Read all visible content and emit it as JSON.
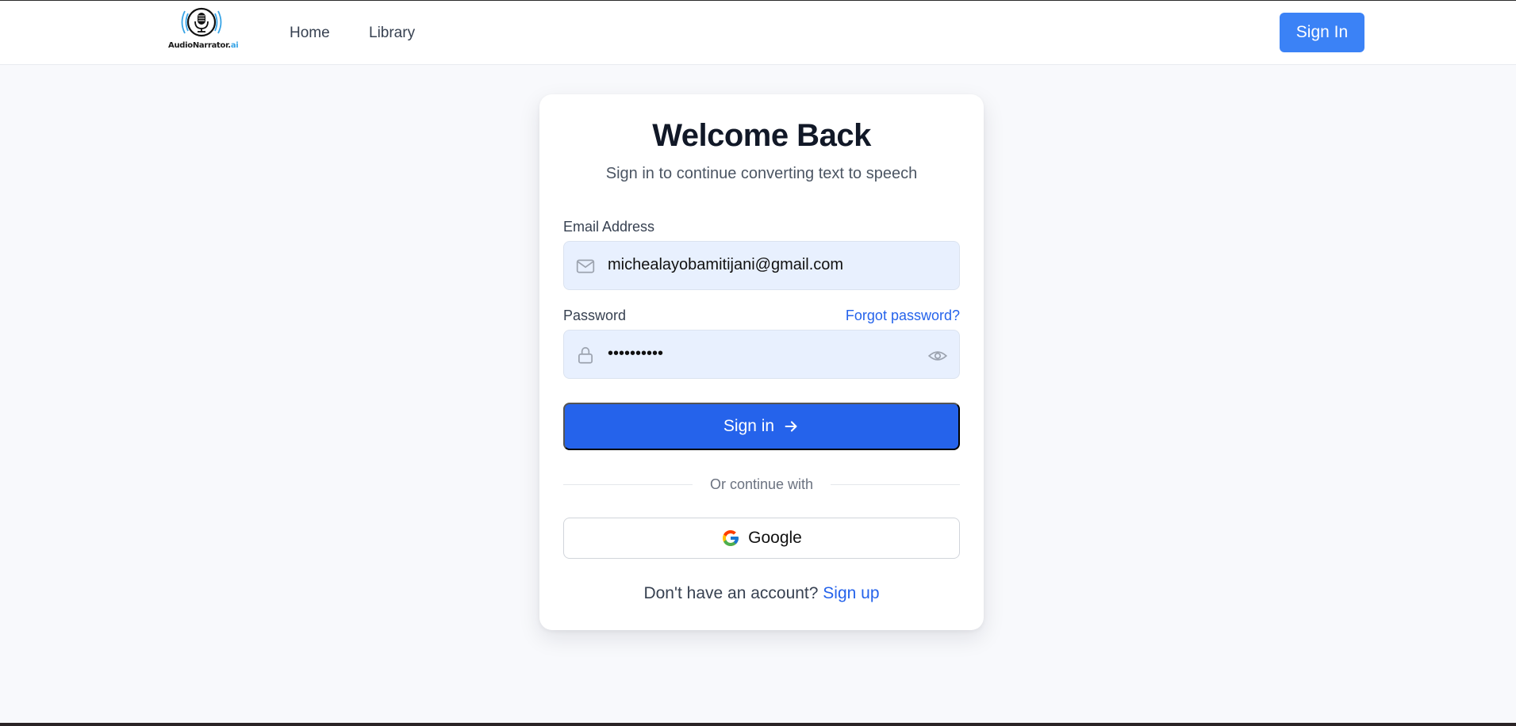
{
  "brand": {
    "logo_text": "AudioNarrator.",
    "logo_suffix": "ai"
  },
  "nav": {
    "home": "Home",
    "library": "Library",
    "sign_in": "Sign In"
  },
  "card": {
    "title": "Welcome Back",
    "subtitle": "Sign in to continue converting text to speech",
    "email": {
      "label": "Email Address",
      "value": "michealayobamitijani@gmail.com"
    },
    "password": {
      "label": "Password",
      "value": "••••••••••",
      "forgot": "Forgot password?"
    },
    "submit": "Sign in",
    "divider": "Or continue with",
    "google": "Google",
    "signup_prompt": "Don't have an account?",
    "signup_link": "Sign up"
  },
  "icons": {
    "logo": "microphone-icon",
    "email": "mail-icon",
    "password": "lock-icon",
    "toggle": "eye-icon",
    "submit": "arrow-right-icon",
    "google": "google-icon"
  },
  "colors": {
    "primary": "#2563eb",
    "nav_button": "#3b82f6",
    "input_bg": "#e8f0fe",
    "page_bg": "#f8f9fc"
  }
}
